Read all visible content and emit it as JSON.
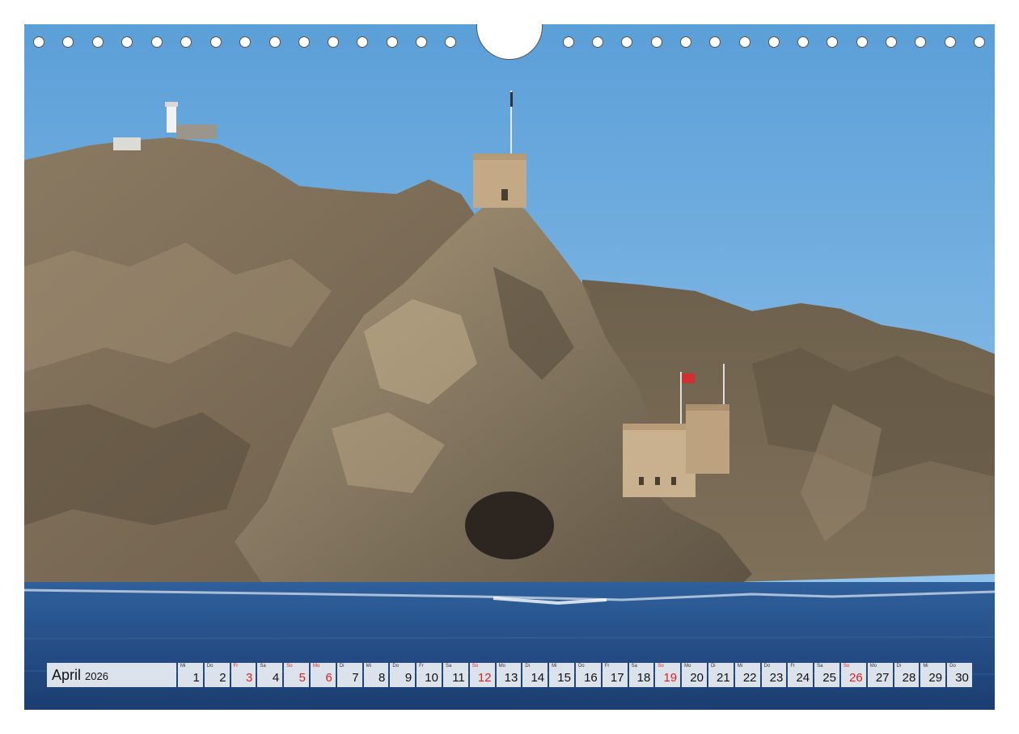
{
  "calendar": {
    "month": "April",
    "year": "2026",
    "days": [
      {
        "wd": "Mi",
        "d": "1",
        "red": false
      },
      {
        "wd": "Do",
        "d": "2",
        "red": false
      },
      {
        "wd": "Fr",
        "d": "3",
        "red": true
      },
      {
        "wd": "Sa",
        "d": "4",
        "red": false
      },
      {
        "wd": "So",
        "d": "5",
        "red": true
      },
      {
        "wd": "Mo",
        "d": "6",
        "red": true
      },
      {
        "wd": "Di",
        "d": "7",
        "red": false
      },
      {
        "wd": "Mi",
        "d": "8",
        "red": false
      },
      {
        "wd": "Do",
        "d": "9",
        "red": false
      },
      {
        "wd": "Fr",
        "d": "10",
        "red": false
      },
      {
        "wd": "Sa",
        "d": "11",
        "red": false
      },
      {
        "wd": "So",
        "d": "12",
        "red": true
      },
      {
        "wd": "Mo",
        "d": "13",
        "red": false
      },
      {
        "wd": "Di",
        "d": "14",
        "red": false
      },
      {
        "wd": "Mi",
        "d": "15",
        "red": false
      },
      {
        "wd": "Do",
        "d": "16",
        "red": false
      },
      {
        "wd": "Fr",
        "d": "17",
        "red": false
      },
      {
        "wd": "Sa",
        "d": "18",
        "red": false
      },
      {
        "wd": "So",
        "d": "19",
        "red": true
      },
      {
        "wd": "Mo",
        "d": "20",
        "red": false
      },
      {
        "wd": "Di",
        "d": "21",
        "red": false
      },
      {
        "wd": "Mi",
        "d": "22",
        "red": false
      },
      {
        "wd": "Do",
        "d": "23",
        "red": false
      },
      {
        "wd": "Fr",
        "d": "24",
        "red": false
      },
      {
        "wd": "Sa",
        "d": "25",
        "red": false
      },
      {
        "wd": "So",
        "d": "26",
        "red": true
      },
      {
        "wd": "Mo",
        "d": "27",
        "red": false
      },
      {
        "wd": "Di",
        "d": "28",
        "red": false
      },
      {
        "wd": "Mi",
        "d": "29",
        "red": false
      },
      {
        "wd": "Do",
        "d": "30",
        "red": false
      }
    ]
  },
  "colors": {
    "sky_top": "#5b9fd8",
    "sky_bottom": "#8fc0e8",
    "rock_dark": "#5e5343",
    "rock_mid": "#8a7a62",
    "rock_light": "#b3a080",
    "sea_top": "#2c5d9a",
    "sea_bottom": "#1c3f73",
    "fort": "#c9b08e",
    "holiday_red": "#e02020"
  }
}
